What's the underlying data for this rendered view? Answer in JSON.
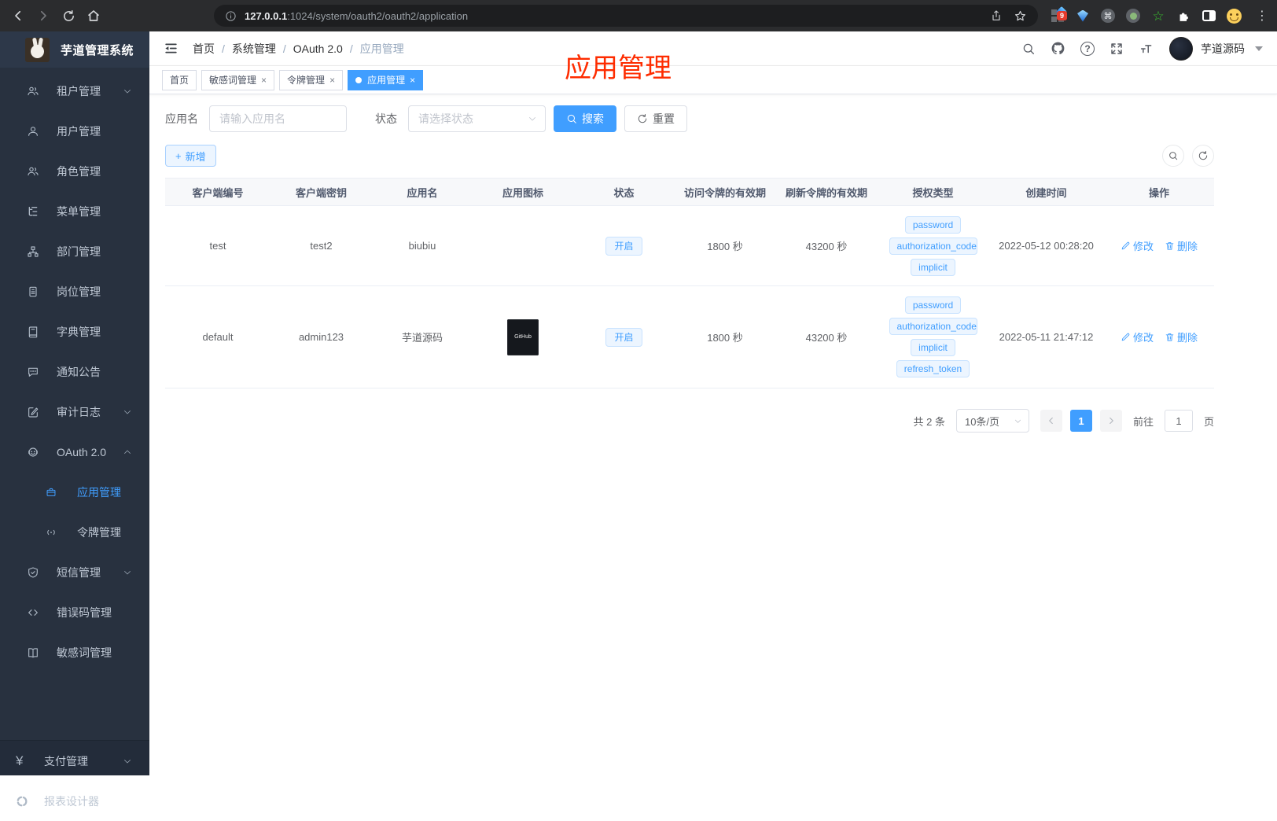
{
  "theme": {
    "accent": "#409eff",
    "annotation_color": "#fe2c00",
    "sidebar_bg": "#28313f",
    "tag_bg": "#ecf5ff"
  },
  "browser": {
    "url_host": "127.0.0.1",
    "url_path": ":1024/system/oauth2/oauth2/application",
    "extension_badge": "9"
  },
  "sidebar": {
    "app_title": "芋道管理系统",
    "items": [
      {
        "label": "租户管理"
      },
      {
        "label": "用户管理"
      },
      {
        "label": "角色管理"
      },
      {
        "label": "菜单管理"
      },
      {
        "label": "部门管理"
      },
      {
        "label": "岗位管理"
      },
      {
        "label": "字典管理"
      },
      {
        "label": "通知公告"
      },
      {
        "label": "审计日志"
      },
      {
        "label": "OAuth 2.0"
      },
      {
        "label": "应用管理"
      },
      {
        "label": "令牌管理"
      },
      {
        "label": "短信管理"
      },
      {
        "label": "错误码管理"
      },
      {
        "label": "敏感词管理"
      },
      {
        "label": "支付管理"
      },
      {
        "label": "报表设计器"
      }
    ]
  },
  "header": {
    "breadcrumb": [
      "首页",
      "系统管理",
      "OAuth 2.0",
      "应用管理"
    ],
    "user_name": "芋道源码"
  },
  "tabs": [
    {
      "label": "首页"
    },
    {
      "label": "敏感词管理"
    },
    {
      "label": "令牌管理"
    },
    {
      "label": "应用管理"
    }
  ],
  "annotation": {
    "text": "应用管理"
  },
  "filters": {
    "name_label": "应用名",
    "name_placeholder": "请输入应用名",
    "status_label": "状态",
    "status_placeholder": "请选择状态",
    "search_label": "搜索",
    "reset_label": "重置"
  },
  "toolbar": {
    "add_label": "新增"
  },
  "table": {
    "columns": [
      "客户端编号",
      "客户端密钥",
      "应用名",
      "应用图标",
      "状态",
      "访问令牌的有效期",
      "刷新令牌的有效期",
      "授权类型",
      "创建时间",
      "操作"
    ],
    "edit_label": "修改",
    "delete_label": "删除",
    "rows": [
      {
        "client_id": "test",
        "secret": "test2",
        "name": "biubiu",
        "status": "开启",
        "access_validity": "1800 秒",
        "refresh_validity": "43200 秒",
        "grants": [
          "password",
          "authorization_code",
          "implicit"
        ],
        "created": "2022-05-12 00:28:20"
      },
      {
        "client_id": "default",
        "secret": "admin123",
        "name": "芋道源码",
        "icon_text": "GitHub",
        "status": "开启",
        "access_validity": "1800 秒",
        "refresh_validity": "43200 秒",
        "grants": [
          "password",
          "authorization_code",
          "implicit",
          "refresh_token"
        ],
        "created": "2022-05-11 21:47:12"
      }
    ]
  },
  "pagination": {
    "total": "共 2 条",
    "page_size": "10条/页",
    "page": "1",
    "goto_label": "前往",
    "goto_value": "1",
    "unit_label": "页"
  }
}
